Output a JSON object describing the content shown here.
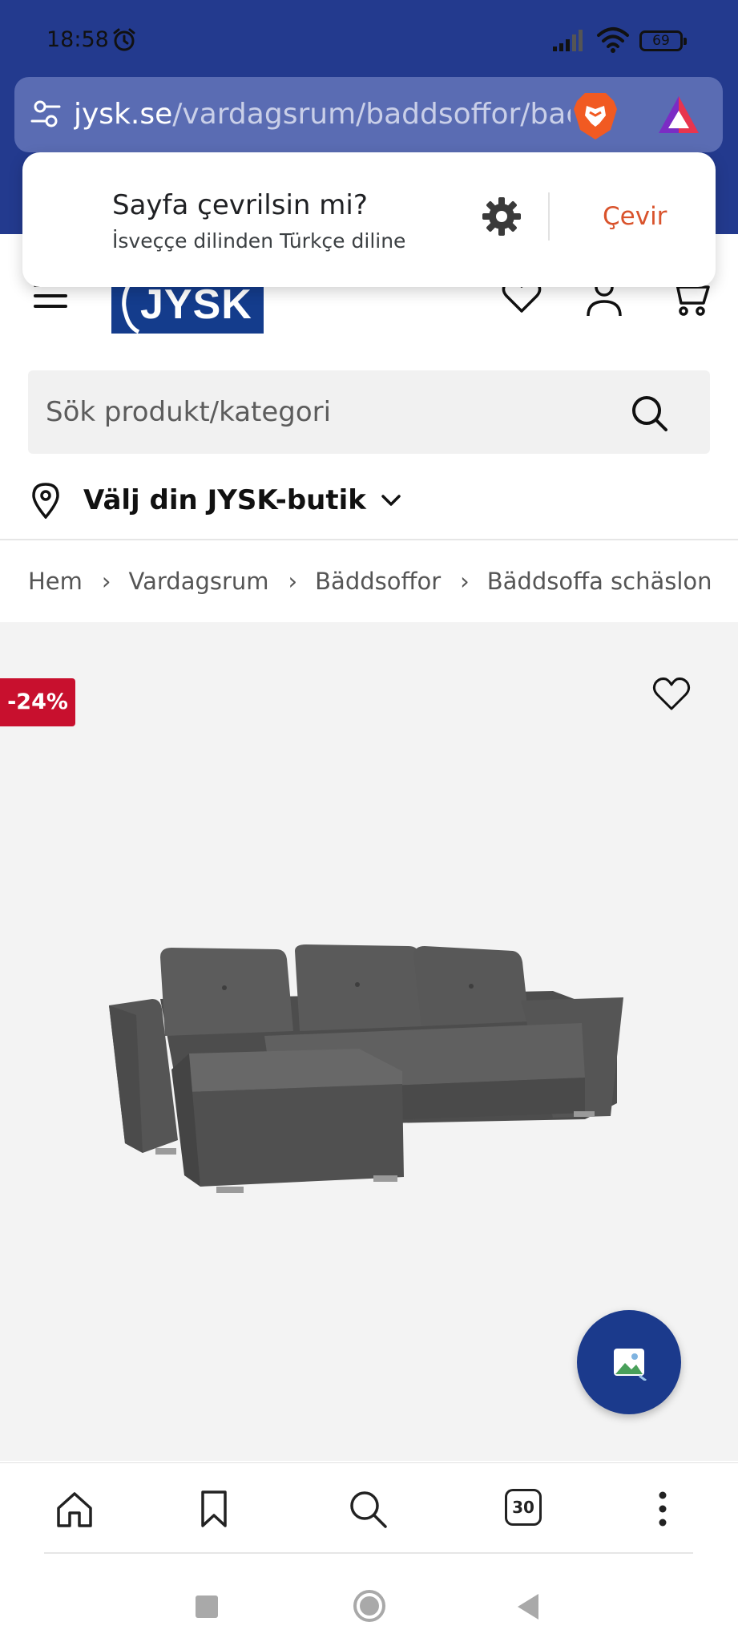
{
  "status_bar": {
    "time": "18:58",
    "battery": "69",
    "icons": [
      "alarm-icon",
      "signal-icon",
      "wifi-icon",
      "battery-icon"
    ]
  },
  "browser": {
    "url_host": "jysk.se",
    "url_path": "/vardagsrum/baddsoffor/bac",
    "icons": [
      "tune-icon",
      "brave-shields-icon",
      "brave-rewards-icon"
    ],
    "colors": {
      "chrome": "#233a8e",
      "urlbar": "#5a6cb3"
    }
  },
  "translate": {
    "title": "Sayfa çevrilsin mi?",
    "subtitle": "İsveççe dilinden Türkçe diline",
    "action_label": "Çevir",
    "icons": [
      "settings-gear-icon"
    ],
    "colors": {
      "action": "#d9532c"
    }
  },
  "header": {
    "logo_text": "JYSK",
    "icons": [
      "hamburger-menu-icon",
      "heart-icon",
      "account-icon",
      "cart-icon"
    ],
    "colors": {
      "brand": "#143c8c"
    }
  },
  "search": {
    "placeholder": "Sök produkt/kategori",
    "value": ""
  },
  "store": {
    "label": "Välj din JYSK-butik"
  },
  "breadcrumb": {
    "items": [
      "Hem",
      "Vardagsrum",
      "Bäddsoffor",
      "Bäddsoffa schäslong VEJL"
    ],
    "separator": "›"
  },
  "product": {
    "discount_badge": "-24%",
    "colors": {
      "badge": "#c8102e",
      "fab": "#1b3a8c"
    }
  },
  "bottom_toolbar": {
    "tab_count": "30",
    "icons": [
      "home-icon",
      "bookmark-icon",
      "search-icon",
      "tabs-icon",
      "more-vert-icon"
    ]
  },
  "system_nav": {
    "icons": [
      "recents-icon",
      "home-circle-icon",
      "back-icon"
    ]
  }
}
